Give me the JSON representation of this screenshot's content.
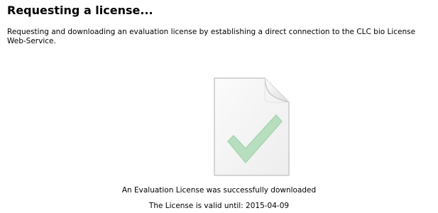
{
  "header": {
    "title": "Requesting a license...",
    "description": "Requesting and downloading an evaluation license by establishing a direct connection to the CLC bio License Web-Service."
  },
  "status": {
    "icon": "document-checkmark-icon",
    "message": "An Evaluation License was successfully downloaded",
    "validity": "The License is valid until: 2015-04-09"
  },
  "colors": {
    "checkmark": "#b7dfbf",
    "document_border": "#c8c8c8",
    "document_fill": "#f4f4f4"
  }
}
